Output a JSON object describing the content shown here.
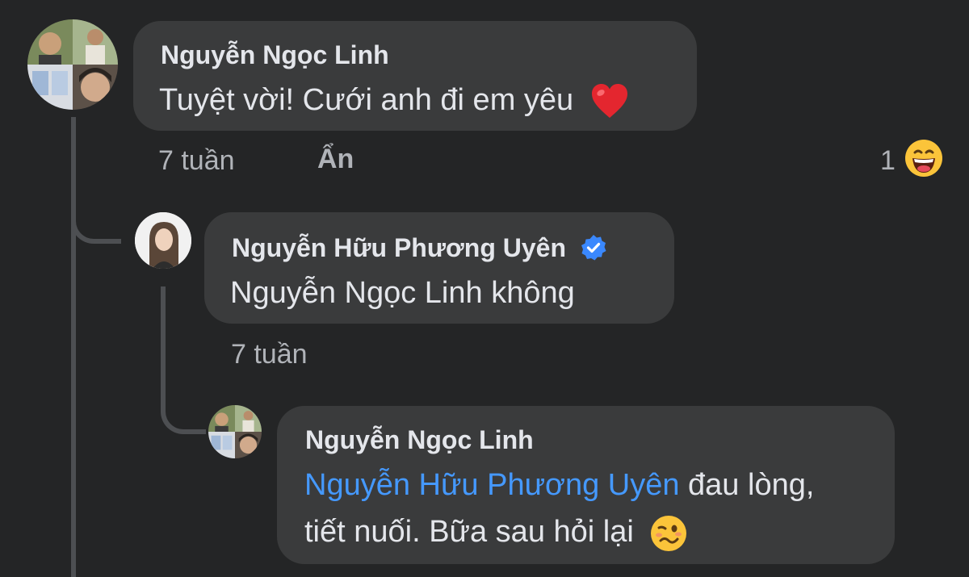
{
  "comments": [
    {
      "author": "Nguyễn Ngọc Linh",
      "text": "Tuyệt vời! Cưới anh đi em yêu",
      "emoji": "❤️",
      "emoji_name": "red-heart",
      "time": "7 tuần",
      "action": "Ẩn",
      "reaction_count": "1",
      "reaction_emoji_name": "laughing-face"
    },
    {
      "author": "Nguyễn Hữu Phương Uyên",
      "verified": true,
      "verified_color": "#3a88fe",
      "text": "Nguyễn Ngọc Linh không",
      "time": "7 tuần"
    },
    {
      "author": "Nguyễn Ngọc Linh",
      "mention": "Nguyễn Hữu Phương Uyên",
      "text_after_mention": " đau lòng,",
      "text_line2": "tiết nuối. Bữa sau hỏi lại",
      "emoji_name": "woozy-face"
    }
  ],
  "colors": {
    "background": "#242526",
    "bubble": "#3a3b3c",
    "link": "#4599ff",
    "meta_text": "#b0b3b8"
  }
}
